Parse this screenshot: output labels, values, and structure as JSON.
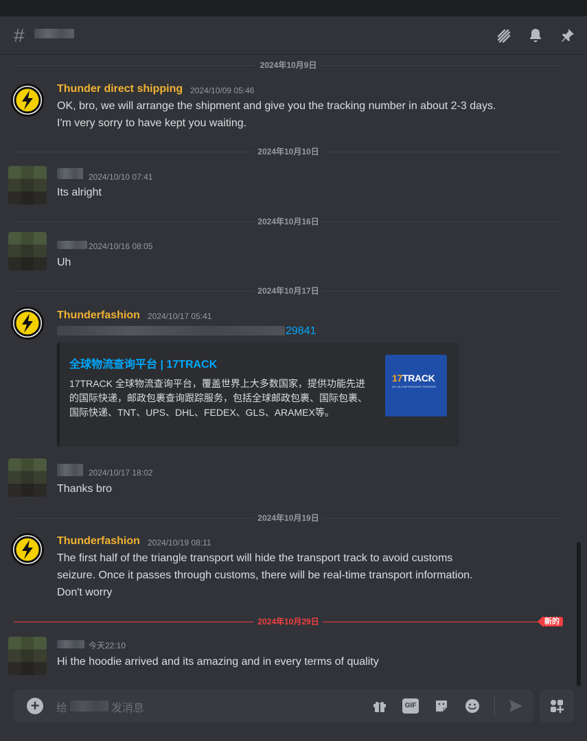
{
  "header": {
    "hash": "#",
    "icons": [
      "threads-icon",
      "bell-icon",
      "pin-icon"
    ]
  },
  "dividers": [
    {
      "label": "2024年10月9日"
    },
    {
      "label": "2024年10月10日"
    },
    {
      "label": "2024年10月16日"
    },
    {
      "label": "2024年10月17日"
    },
    {
      "label": "2024年10月19日"
    },
    {
      "label": "2024年10月29日",
      "new_badge": "新的"
    }
  ],
  "messages": [
    {
      "author": "Thunder direct shipping",
      "timestamp": "2024/10/09 05:46",
      "lines": [
        "OK, bro, we will arrange the shipment and give you the tracking number in about 2-3 days.",
        "I'm very sorry to have kept you waiting."
      ]
    },
    {
      "author": "",
      "timestamp": "2024/10/10 07:41",
      "lines": [
        "Its alright"
      ]
    },
    {
      "author": "",
      "timestamp": "2024/10/16 08:05",
      "lines": [
        "Uh"
      ]
    },
    {
      "author": "Thunderfashion",
      "timestamp": "2024/10/17 05:41",
      "link_tail": "29841",
      "embed": {
        "title": "全球物流查询平台 | 17TRACK",
        "description": "17TRACK 全球物流查询平台，覆盖世界上大多数国家，提供功能先进的国际快递，邮政包裹查询跟踪服务，包括全球邮政包裹、国际包裹、国际快递、TNT、UPS、DHL、FEDEX、GLS、ARAMEX等。",
        "thumb_logo_a": "17",
        "thumb_logo_b": "TRACK",
        "thumb_sub": "ALL-IN-ONE PACKAGE TRACKING"
      }
    },
    {
      "author": "",
      "timestamp": "2024/10/17 18:02",
      "lines": [
        "Thanks bro"
      ]
    },
    {
      "author": "Thunderfashion",
      "timestamp": "2024/10/19 08:11",
      "lines": [
        "The first half of the triangle transport will hide the transport track to avoid customs",
        "seizure. Once it passes through customs, there will be real-time transport information.",
        "Don't worry"
      ]
    },
    {
      "author": "",
      "timestamp": "今天22:10",
      "lines": [
        "Hi the hoodie arrived and its amazing and in every terms of quality"
      ]
    }
  ],
  "composer": {
    "placeholder_prefix": "给",
    "placeholder_suffix": "发消息",
    "icons": [
      "plus-icon",
      "gift-icon",
      "gif-icon",
      "sticker-icon",
      "emoji-icon",
      "send-icon",
      "apps-icon"
    ],
    "gif_label": "GIF"
  },
  "colors": {
    "background": "#313338",
    "author_gold": "#f0b232",
    "link_blue": "#00a8fc",
    "new_red": "#f23f43"
  }
}
